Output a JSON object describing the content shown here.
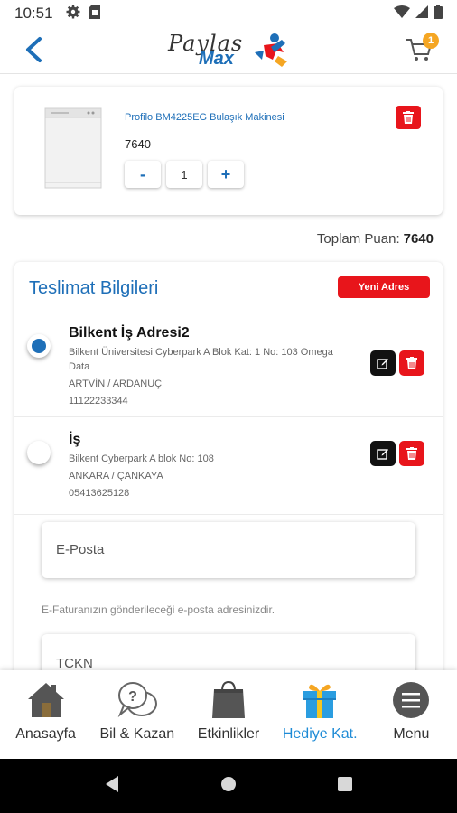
{
  "status_bar": {
    "time": "10:51",
    "icons": [
      "gear-icon",
      "sim-icon",
      "wifi-icon",
      "signal-icon",
      "battery-icon"
    ]
  },
  "header": {
    "logo_word_1": "Paylas",
    "logo_word_2": "Max",
    "cart_count": "1"
  },
  "cart_item": {
    "name": "Profilo BM4225EG Bulaşık Makinesi",
    "points": "7640",
    "quantity": "1",
    "minus_label": "-",
    "plus_label": "+"
  },
  "total": {
    "label": "Toplam Puan:",
    "value": "7640"
  },
  "delivery": {
    "title": "Teslimat Bilgileri",
    "new_address_label": "Yeni Adres",
    "addresses": [
      {
        "title": "Bilkent İş Adresi2",
        "line1": "Bilkent Üniversitesi Cyberpark A Blok Kat: 1 No: 103 Omega Data",
        "city": "ARTVİN / ARDANUÇ",
        "phone": "11122233344",
        "selected": true
      },
      {
        "title": "İş",
        "line1": "Bilkent Cyberpark A blok No: 108",
        "city": "ANKARA / ÇANKAYA",
        "phone": "05413625128",
        "selected": false
      }
    ],
    "email_placeholder": "E-Posta",
    "email_hint": "E-Faturanızın gönderileceği e-posta adresinizdir.",
    "tckn_placeholder": "TCKN"
  },
  "bottom_nav": {
    "items": [
      {
        "label": "Anasayfa",
        "icon": "house-icon"
      },
      {
        "label": "Bil & Kazan",
        "icon": "question-bubble-icon"
      },
      {
        "label": "Etkinlikler",
        "icon": "shopping-bag-icon"
      },
      {
        "label": "Hediye Kat.",
        "icon": "gift-icon",
        "active": true
      },
      {
        "label": "Menu",
        "icon": "menu-icon"
      }
    ]
  },
  "colors": {
    "brand_blue": "#1e6fb8",
    "active_nav": "#1e8bd6",
    "danger_red": "#e8151b",
    "badge_orange": "#f5a623"
  }
}
